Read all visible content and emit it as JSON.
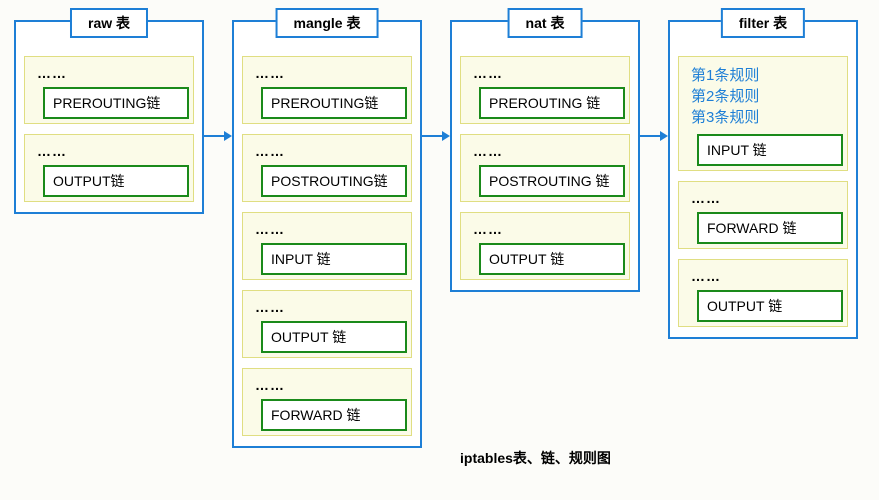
{
  "caption": "iptables表、链、规则图",
  "tables": [
    {
      "title": "raw 表",
      "chains": [
        {
          "rules_text": "……",
          "name": "PREROUTING链"
        },
        {
          "rules_text": "……",
          "name": "OUTPUT链"
        }
      ]
    },
    {
      "title": "mangle 表",
      "chains": [
        {
          "rules_text": "……",
          "name": "PREROUTING链"
        },
        {
          "rules_text": "……",
          "name": "POSTROUTING链"
        },
        {
          "rules_text": "……",
          "name": "INPUT 链"
        },
        {
          "rules_text": "……",
          "name": "OUTPUT 链"
        },
        {
          "rules_text": "……",
          "name": "FORWARD 链"
        }
      ]
    },
    {
      "title": "nat 表",
      "chains": [
        {
          "rules_text": "……",
          "name": "PREROUTING 链"
        },
        {
          "rules_text": "……",
          "name": "POSTROUTING 链"
        },
        {
          "rules_text": "……",
          "name": "OUTPUT 链"
        }
      ]
    },
    {
      "title": "filter 表",
      "chains": [
        {
          "rules_lines": [
            "第1条规则",
            "第2条规则",
            "第3条规则"
          ],
          "name": "INPUT 链"
        },
        {
          "rules_text": "……",
          "name": "FORWARD 链"
        },
        {
          "rules_text": "……",
          "name": "OUTPUT 链"
        }
      ]
    }
  ],
  "chart_data": {
    "type": "table",
    "description": "iptables tables → chains mapping with processing order raw → mangle → nat → filter",
    "tables": {
      "raw": [
        "PREROUTING",
        "OUTPUT"
      ],
      "mangle": [
        "PREROUTING",
        "POSTROUTING",
        "INPUT",
        "OUTPUT",
        "FORWARD"
      ],
      "nat": [
        "PREROUTING",
        "POSTROUTING",
        "OUTPUT"
      ],
      "filter": [
        "INPUT",
        "FORWARD",
        "OUTPUT"
      ]
    },
    "order": [
      "raw",
      "mangle",
      "nat",
      "filter"
    ]
  }
}
